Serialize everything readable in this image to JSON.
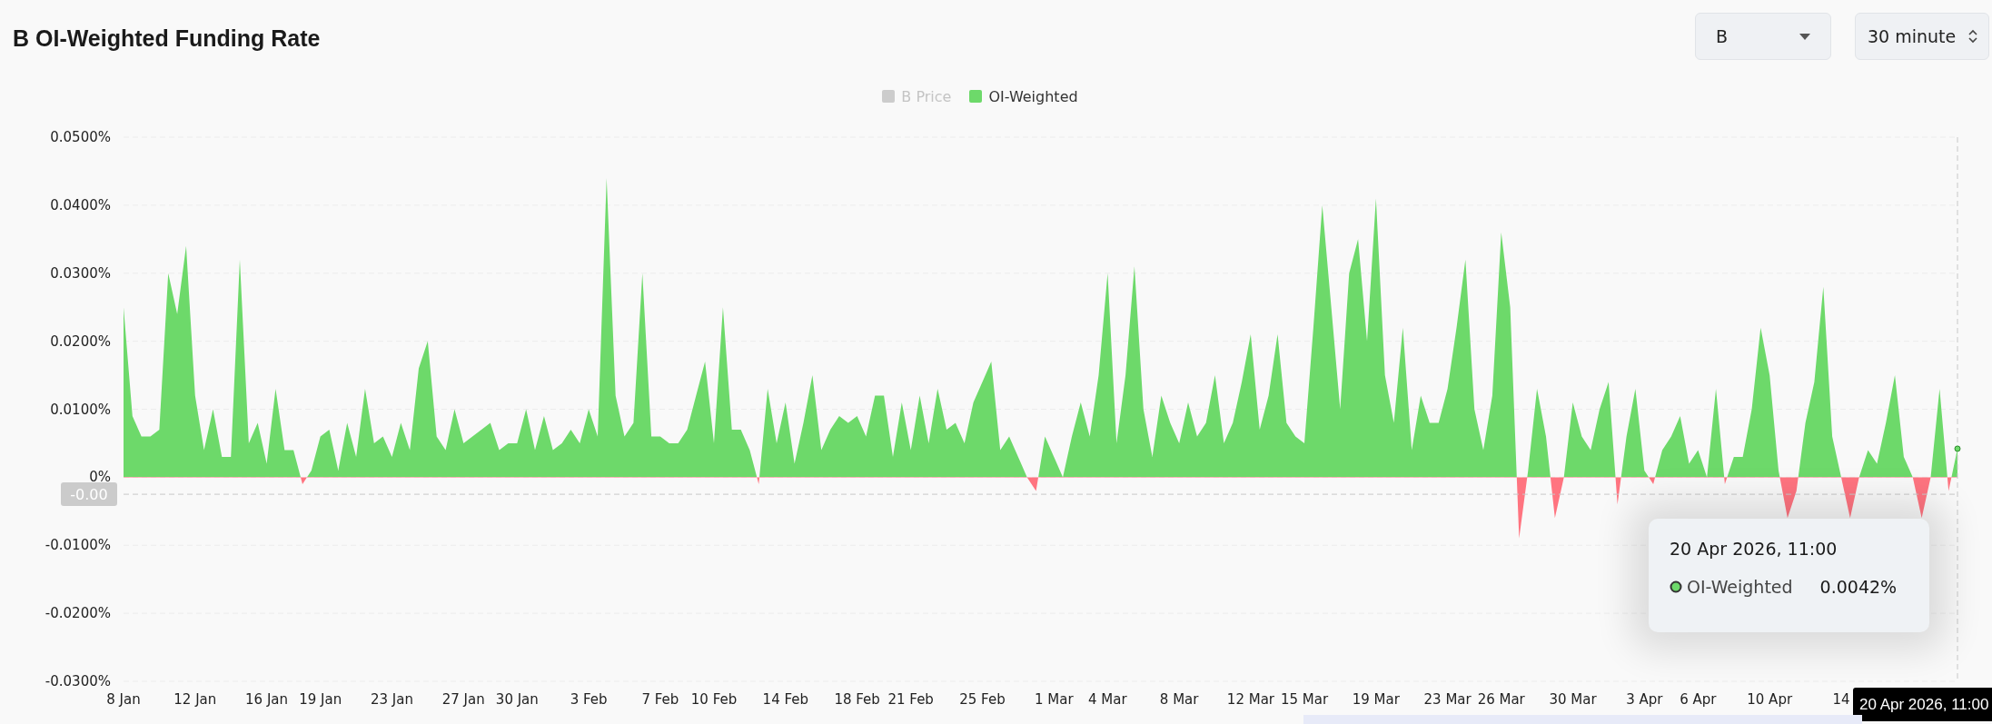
{
  "title": "B OI-Weighted Funding Rate",
  "controls": [
    {
      "kind": "dropdown",
      "value": "B"
    },
    {
      "kind": "stepper",
      "value": "30 minute"
    }
  ],
  "legend": [
    {
      "label": "B Price",
      "hidden": true
    },
    {
      "label": "OI-Weighted",
      "hidden": false
    }
  ],
  "chart": {
    "crosshair": {
      "y_label": "-0.00",
      "x_label": "20 Apr 2026, 11:00"
    },
    "tooltip": {
      "title": "20 Apr 2026, 11:00",
      "value": "0.0042%"
    },
    "chart_data": {
      "type": "area",
      "grid": true,
      "ref_lines": [
        {
          "axis": "y",
          "value": -0.0025
        }
      ],
      "ylim": [
        -0.03,
        0.05
      ],
      "yticks": [
        {
          "value": 0.05,
          "label": "0.0500%"
        },
        {
          "value": 0.04,
          "label": "0.0400%"
        },
        {
          "value": 0.03,
          "label": "0.0300%"
        },
        {
          "value": 0.02,
          "label": "0.0200%"
        },
        {
          "value": 0.01,
          "label": "0.0100%"
        },
        {
          "value": 0,
          "label": "0%"
        },
        {
          "value": -0.01,
          "label": "-0.0100%"
        },
        {
          "value": -0.02,
          "label": "-0.0200%"
        },
        {
          "value": -0.03,
          "label": "-0.0300%"
        }
      ],
      "categories": [
        "8 Jan",
        null,
        null,
        null,
        null,
        null,
        null,
        null,
        "12 Jan",
        null,
        null,
        null,
        null,
        null,
        null,
        null,
        "16 Jan",
        null,
        null,
        null,
        null,
        null,
        "19 Jan",
        null,
        null,
        null,
        null,
        null,
        null,
        null,
        "23 Jan",
        null,
        null,
        null,
        null,
        null,
        null,
        null,
        "27 Jan",
        null,
        null,
        null,
        null,
        null,
        "30 Jan",
        null,
        null,
        null,
        null,
        null,
        null,
        null,
        "3 Feb",
        null,
        null,
        null,
        null,
        null,
        null,
        null,
        "7 Feb",
        null,
        null,
        null,
        null,
        null,
        "10 Feb",
        null,
        null,
        null,
        null,
        null,
        null,
        null,
        "14 Feb",
        null,
        null,
        null,
        null,
        null,
        null,
        null,
        "18 Feb",
        null,
        null,
        null,
        null,
        null,
        "21 Feb",
        null,
        null,
        null,
        null,
        null,
        null,
        null,
        "25 Feb",
        null,
        null,
        null,
        null,
        null,
        null,
        null,
        "1 Mar",
        null,
        null,
        null,
        null,
        null,
        "4 Mar",
        null,
        null,
        null,
        null,
        null,
        null,
        null,
        "8 Mar",
        null,
        null,
        null,
        null,
        null,
        null,
        null,
        "12 Mar",
        null,
        null,
        null,
        null,
        null,
        "15 Mar",
        null,
        null,
        null,
        null,
        null,
        null,
        null,
        "19 Mar",
        null,
        null,
        null,
        null,
        null,
        null,
        null,
        "23 Mar",
        null,
        null,
        null,
        null,
        null,
        "26 Mar",
        null,
        null,
        null,
        null,
        null,
        null,
        null,
        "30 Mar",
        null,
        null,
        null,
        null,
        null,
        null,
        null,
        "3 Apr",
        null,
        null,
        null,
        null,
        null,
        "6 Apr",
        null,
        null,
        null,
        null,
        null,
        null,
        null,
        "10 Apr",
        null,
        null,
        null,
        null,
        null,
        null,
        null,
        "14",
        null,
        null,
        null,
        null,
        null,
        null,
        null,
        null,
        null,
        null,
        null,
        null,
        null
      ],
      "series": [
        {
          "name": "OI-Weighted",
          "color": "#6dd96a",
          "values": [
            0.025,
            0.009,
            0.006,
            0.006,
            0.007,
            0.03,
            0.024,
            0.034,
            0.012,
            0.004,
            0.01,
            0.003,
            0.003,
            0.032,
            0.005,
            0.008,
            0.002,
            0.013,
            0.004,
            0.004,
            -0.001,
            0.001,
            0.006,
            0.007,
            0.001,
            0.008,
            0.003,
            0.013,
            0.005,
            0.006,
            0.003,
            0.008,
            0.004,
            0.016,
            0.02,
            0.006,
            0.004,
            0.01,
            0.005,
            0.006,
            0.007,
            0.008,
            0.004,
            0.005,
            0.005,
            0.01,
            0.004,
            0.009,
            0.004,
            0.005,
            0.007,
            0.005,
            0.01,
            0.006,
            0.044,
            0.012,
            0.006,
            0.008,
            0.03,
            0.006,
            0.006,
            0.005,
            0.005,
            0.007,
            0.012,
            0.017,
            0.005,
            0.025,
            0.007,
            0.007,
            0.004,
            -0.001,
            0.013,
            0.005,
            0.011,
            0.002,
            0.008,
            0.015,
            0.004,
            0.007,
            0.009,
            0.008,
            0.009,
            0.006,
            0.012,
            0.012,
            0.003,
            0.011,
            0.004,
            0.012,
            0.005,
            0.013,
            0.007,
            0.008,
            0.005,
            0.011,
            0.014,
            0.017,
            0.004,
            0.006,
            0.003,
            0.0,
            -0.002,
            0.006,
            0.003,
            0.0,
            0.006,
            0.011,
            0.006,
            0.015,
            0.03,
            0.005,
            0.015,
            0.031,
            0.01,
            0.003,
            0.012,
            0.008,
            0.005,
            0.011,
            0.006,
            0.008,
            0.015,
            0.005,
            0.008,
            0.014,
            0.021,
            0.007,
            0.012,
            0.021,
            0.008,
            0.006,
            0.005,
            0.022,
            0.04,
            0.025,
            0.01,
            0.03,
            0.035,
            0.02,
            0.041,
            0.015,
            0.008,
            0.022,
            0.004,
            0.012,
            0.008,
            0.008,
            0.013,
            0.022,
            0.032,
            0.01,
            0.004,
            0.012,
            0.036,
            0.025,
            -0.009,
            0.001,
            0.013,
            0.006,
            -0.006,
            0.0,
            0.011,
            0.006,
            0.004,
            0.01,
            0.014,
            -0.004,
            0.006,
            0.013,
            0.001,
            -0.001,
            0.004,
            0.006,
            0.009,
            0.002,
            0.004,
            0.0,
            0.013,
            -0.001,
            0.003,
            0.003,
            0.01,
            0.022,
            0.015,
            0.001,
            -0.006,
            -0.002,
            0.008,
            0.014,
            0.028,
            0.006,
            0.0,
            -0.006,
            0.0,
            0.004,
            0.002,
            0.008,
            0.015,
            0.003,
            0.0,
            -0.006,
            0.0,
            0.013,
            -0.002,
            0.0042
          ]
        }
      ]
    }
  }
}
